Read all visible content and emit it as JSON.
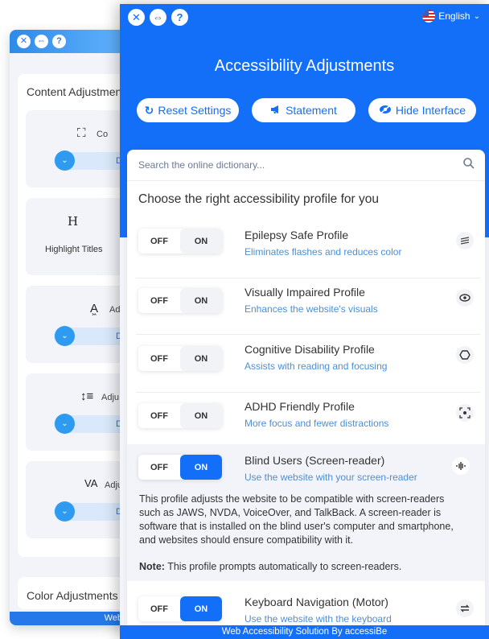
{
  "back_panel": {
    "content_title": "Content Adjustments",
    "tiles": [
      {
        "icon": "fullscreen-icon",
        "label": "Co",
        "toggle_text": "D"
      },
      {
        "icon": "heading-icon",
        "label": "Highlight Titles"
      },
      {
        "icon": "font-size-icon",
        "label": "Adju",
        "toggle_text": "D"
      },
      {
        "icon": "line-height-icon",
        "label": "Adju",
        "toggle_text": "D"
      },
      {
        "icon": "letter-spacing-icon",
        "label": "Adjus",
        "toggle_text": "D"
      }
    ],
    "color_title": "Color Adjustments",
    "footer": "Web"
  },
  "header": {
    "title": "Accessibility Adjustments",
    "language": "English",
    "buttons": {
      "reset": "Reset Settings",
      "statement": "Statement",
      "hide": "Hide Interface"
    }
  },
  "search": {
    "placeholder": "Search the online dictionary..."
  },
  "profiles_heading": "Choose the right accessibility profile for you",
  "toggle_labels": {
    "off": "OFF",
    "on": "ON"
  },
  "profiles": [
    {
      "name": "Epilepsy Safe Profile",
      "description": "Eliminates flashes and reduces color",
      "icon": "lightning-off-icon",
      "active": false
    },
    {
      "name": "Visually Impaired Profile",
      "description": "Enhances the website's visuals",
      "icon": "eye-icon",
      "active": false
    },
    {
      "name": "Cognitive Disability Profile",
      "description": "Assists with reading and focusing",
      "icon": "brain-icon",
      "active": false
    },
    {
      "name": "ADHD Friendly Profile",
      "description": "More focus and fewer distractions",
      "icon": "focus-icon",
      "active": false
    },
    {
      "name": "Blind Users (Screen-reader)",
      "description": "Use the website with your screen-reader",
      "icon": "audio-wave-icon",
      "active": true,
      "details": "This profile adjusts the website to be compatible with screen-readers such as JAWS, NVDA, VoiceOver, and TalkBack. A screen-reader is software that is installed on the blind user's computer and smartphone, and websites should ensure compatibility with it.",
      "note_label": "Note:",
      "note_text": " This profile prompts automatically to screen-readers."
    },
    {
      "name": "Keyboard Navigation (Motor)",
      "description": "Use the website with the keyboard",
      "icon": "arrows-icon",
      "active": true
    }
  ],
  "footer": "Web Accessibility Solution By accessiBe",
  "colors": {
    "primary": "#146ff8",
    "accent_text": "#4b8fd6",
    "panel_bg": "#f2f4f9"
  }
}
